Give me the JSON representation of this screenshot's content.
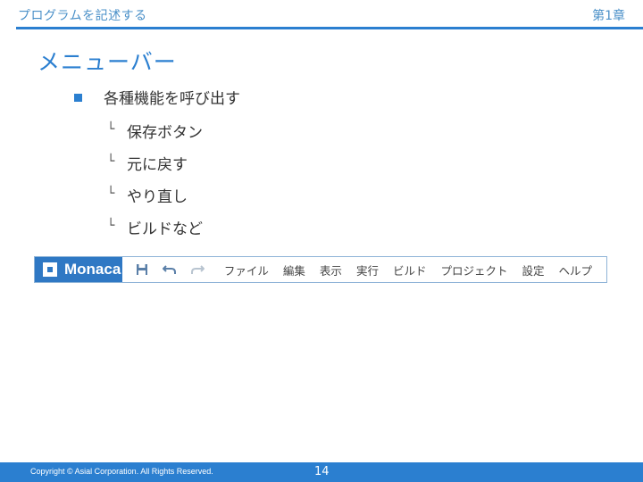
{
  "header": {
    "section_title": "プログラムを記述する",
    "chapter": "第1章"
  },
  "slide": {
    "title": "メニューバー",
    "bullet": "各種機能を呼び出す",
    "sub_marker": "└",
    "sub_items": [
      "保存ボタン",
      "元に戻す",
      "やり直し",
      "ビルドなど"
    ]
  },
  "menubar": {
    "logo_text": "Monaca",
    "icons": [
      "save-icon",
      "undo-icon",
      "redo-icon"
    ],
    "items": [
      "ファイル",
      "編集",
      "表示",
      "実行",
      "ビルド",
      "プロジェクト",
      "設定",
      "ヘルプ"
    ]
  },
  "footer": {
    "copyright": "Copyright © Asial Corporation. All Rights Reserved.",
    "page_number": "14"
  },
  "colors": {
    "accent": "#2b7fd0",
    "logo_bg": "#2f78c4"
  }
}
